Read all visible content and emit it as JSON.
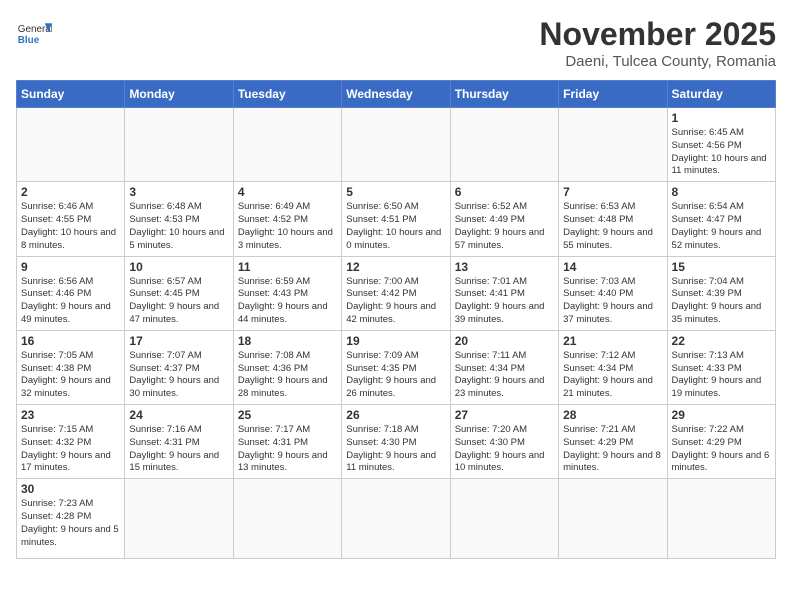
{
  "header": {
    "logo_general": "General",
    "logo_blue": "Blue",
    "month_title": "November 2025",
    "subtitle": "Daeni, Tulcea County, Romania"
  },
  "days_of_week": [
    "Sunday",
    "Monday",
    "Tuesday",
    "Wednesday",
    "Thursday",
    "Friday",
    "Saturday"
  ],
  "weeks": [
    [
      {
        "day": "",
        "content": ""
      },
      {
        "day": "",
        "content": ""
      },
      {
        "day": "",
        "content": ""
      },
      {
        "day": "",
        "content": ""
      },
      {
        "day": "",
        "content": ""
      },
      {
        "day": "",
        "content": ""
      },
      {
        "day": "1",
        "content": "Sunrise: 6:45 AM\nSunset: 4:56 PM\nDaylight: 10 hours and 11 minutes."
      }
    ],
    [
      {
        "day": "2",
        "content": "Sunrise: 6:46 AM\nSunset: 4:55 PM\nDaylight: 10 hours and 8 minutes."
      },
      {
        "day": "3",
        "content": "Sunrise: 6:48 AM\nSunset: 4:53 PM\nDaylight: 10 hours and 5 minutes."
      },
      {
        "day": "4",
        "content": "Sunrise: 6:49 AM\nSunset: 4:52 PM\nDaylight: 10 hours and 3 minutes."
      },
      {
        "day": "5",
        "content": "Sunrise: 6:50 AM\nSunset: 4:51 PM\nDaylight: 10 hours and 0 minutes."
      },
      {
        "day": "6",
        "content": "Sunrise: 6:52 AM\nSunset: 4:49 PM\nDaylight: 9 hours and 57 minutes."
      },
      {
        "day": "7",
        "content": "Sunrise: 6:53 AM\nSunset: 4:48 PM\nDaylight: 9 hours and 55 minutes."
      },
      {
        "day": "8",
        "content": "Sunrise: 6:54 AM\nSunset: 4:47 PM\nDaylight: 9 hours and 52 minutes."
      }
    ],
    [
      {
        "day": "9",
        "content": "Sunrise: 6:56 AM\nSunset: 4:46 PM\nDaylight: 9 hours and 49 minutes."
      },
      {
        "day": "10",
        "content": "Sunrise: 6:57 AM\nSunset: 4:45 PM\nDaylight: 9 hours and 47 minutes."
      },
      {
        "day": "11",
        "content": "Sunrise: 6:59 AM\nSunset: 4:43 PM\nDaylight: 9 hours and 44 minutes."
      },
      {
        "day": "12",
        "content": "Sunrise: 7:00 AM\nSunset: 4:42 PM\nDaylight: 9 hours and 42 minutes."
      },
      {
        "day": "13",
        "content": "Sunrise: 7:01 AM\nSunset: 4:41 PM\nDaylight: 9 hours and 39 minutes."
      },
      {
        "day": "14",
        "content": "Sunrise: 7:03 AM\nSunset: 4:40 PM\nDaylight: 9 hours and 37 minutes."
      },
      {
        "day": "15",
        "content": "Sunrise: 7:04 AM\nSunset: 4:39 PM\nDaylight: 9 hours and 35 minutes."
      }
    ],
    [
      {
        "day": "16",
        "content": "Sunrise: 7:05 AM\nSunset: 4:38 PM\nDaylight: 9 hours and 32 minutes."
      },
      {
        "day": "17",
        "content": "Sunrise: 7:07 AM\nSunset: 4:37 PM\nDaylight: 9 hours and 30 minutes."
      },
      {
        "day": "18",
        "content": "Sunrise: 7:08 AM\nSunset: 4:36 PM\nDaylight: 9 hours and 28 minutes."
      },
      {
        "day": "19",
        "content": "Sunrise: 7:09 AM\nSunset: 4:35 PM\nDaylight: 9 hours and 26 minutes."
      },
      {
        "day": "20",
        "content": "Sunrise: 7:11 AM\nSunset: 4:34 PM\nDaylight: 9 hours and 23 minutes."
      },
      {
        "day": "21",
        "content": "Sunrise: 7:12 AM\nSunset: 4:34 PM\nDaylight: 9 hours and 21 minutes."
      },
      {
        "day": "22",
        "content": "Sunrise: 7:13 AM\nSunset: 4:33 PM\nDaylight: 9 hours and 19 minutes."
      }
    ],
    [
      {
        "day": "23",
        "content": "Sunrise: 7:15 AM\nSunset: 4:32 PM\nDaylight: 9 hours and 17 minutes."
      },
      {
        "day": "24",
        "content": "Sunrise: 7:16 AM\nSunset: 4:31 PM\nDaylight: 9 hours and 15 minutes."
      },
      {
        "day": "25",
        "content": "Sunrise: 7:17 AM\nSunset: 4:31 PM\nDaylight: 9 hours and 13 minutes."
      },
      {
        "day": "26",
        "content": "Sunrise: 7:18 AM\nSunset: 4:30 PM\nDaylight: 9 hours and 11 minutes."
      },
      {
        "day": "27",
        "content": "Sunrise: 7:20 AM\nSunset: 4:30 PM\nDaylight: 9 hours and 10 minutes."
      },
      {
        "day": "28",
        "content": "Sunrise: 7:21 AM\nSunset: 4:29 PM\nDaylight: 9 hours and 8 minutes."
      },
      {
        "day": "29",
        "content": "Sunrise: 7:22 AM\nSunset: 4:29 PM\nDaylight: 9 hours and 6 minutes."
      }
    ],
    [
      {
        "day": "30",
        "content": "Sunrise: 7:23 AM\nSunset: 4:28 PM\nDaylight: 9 hours and 5 minutes."
      },
      {
        "day": "",
        "content": ""
      },
      {
        "day": "",
        "content": ""
      },
      {
        "day": "",
        "content": ""
      },
      {
        "day": "",
        "content": ""
      },
      {
        "day": "",
        "content": ""
      },
      {
        "day": "",
        "content": ""
      }
    ]
  ]
}
